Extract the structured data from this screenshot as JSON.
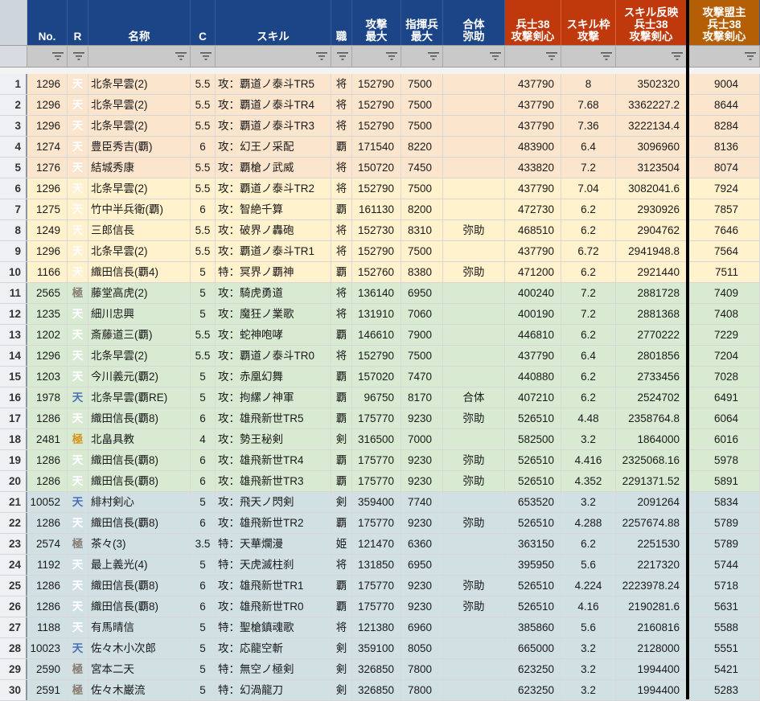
{
  "headers": [
    {
      "key": "no",
      "label": "No.",
      "style": "blue"
    },
    {
      "key": "r",
      "label": "R",
      "style": "blue"
    },
    {
      "key": "name",
      "label": "名称",
      "style": "blue"
    },
    {
      "key": "c",
      "label": "C",
      "style": "blue"
    },
    {
      "key": "skill",
      "label": "スキル",
      "style": "blue"
    },
    {
      "key": "job",
      "label": "職",
      "style": "blue"
    },
    {
      "key": "atk",
      "label": "攻撃\n最大",
      "style": "blue"
    },
    {
      "key": "troops",
      "label": "指揮兵\n最大",
      "style": "blue"
    },
    {
      "key": "combo",
      "label": "合体\n弥助",
      "style": "blue"
    },
    {
      "key": "soldier",
      "label": "兵士38\n攻撃剣心",
      "style": "red"
    },
    {
      "key": "slot",
      "label": "スキル枠\n攻撃",
      "style": "red"
    },
    {
      "key": "reflect",
      "label": "スキル反映\n兵士38\n攻撃剣心",
      "style": "red"
    },
    {
      "key": "lord",
      "label": "攻撃盟主\n兵士38\n攻撃剣心",
      "style": "orange"
    }
  ],
  "colors": {
    "band1": "#fce5cd",
    "band2": "#fff2cc",
    "band3": "#d9ead3",
    "band4": "#d0e0e3"
  },
  "icons": {
    "filter": "filter-icon"
  },
  "rows": [
    {
      "idx": "1",
      "no": "1296",
      "r": "天",
      "rc": "rar-ten",
      "name": "北条早雲(2)",
      "c": "5.5",
      "skill": "攻：覇道ノ泰斗TR5",
      "job": "将",
      "atk": "152790",
      "troops": "7500",
      "combo": "",
      "soldier": "437790",
      "slot": "8",
      "reflect": "3502320",
      "lord": "9004",
      "band": "band1"
    },
    {
      "idx": "2",
      "no": "1296",
      "r": "天",
      "rc": "rar-ten",
      "name": "北条早雲(2)",
      "c": "5.5",
      "skill": "攻：覇道ノ泰斗TR4",
      "job": "将",
      "atk": "152790",
      "troops": "7500",
      "combo": "",
      "soldier": "437790",
      "slot": "7.68",
      "reflect": "3362227.2",
      "lord": "8644",
      "band": "band1"
    },
    {
      "idx": "3",
      "no": "1296",
      "r": "天",
      "rc": "rar-ten",
      "name": "北条早雲(2)",
      "c": "5.5",
      "skill": "攻：覇道ノ泰斗TR3",
      "job": "将",
      "atk": "152790",
      "troops": "7500",
      "combo": "",
      "soldier": "437790",
      "slot": "7.36",
      "reflect": "3222134.4",
      "lord": "8284",
      "band": "band1"
    },
    {
      "idx": "4",
      "no": "1274",
      "r": "天",
      "rc": "rar-ten",
      "name": "豊臣秀吉(覇)",
      "c": "6",
      "skill": "攻：幻王ノ采配",
      "job": "覇",
      "atk": "171540",
      "troops": "8220",
      "combo": "",
      "soldier": "483900",
      "slot": "6.4",
      "reflect": "3096960",
      "lord": "8136",
      "band": "band1"
    },
    {
      "idx": "5",
      "no": "1276",
      "r": "天",
      "rc": "rar-ten",
      "name": "結城秀康",
      "c": "5.5",
      "skill": "攻：覇槍ノ武威",
      "job": "将",
      "atk": "150720",
      "troops": "7450",
      "combo": "",
      "soldier": "433820",
      "slot": "7.2",
      "reflect": "3123504",
      "lord": "8074",
      "band": "band1"
    },
    {
      "idx": "6",
      "no": "1296",
      "r": "天",
      "rc": "rar-ten",
      "name": "北条早雲(2)",
      "c": "5.5",
      "skill": "攻：覇道ノ泰斗TR2",
      "job": "将",
      "atk": "152790",
      "troops": "7500",
      "combo": "",
      "soldier": "437790",
      "slot": "7.04",
      "reflect": "3082041.6",
      "lord": "7924",
      "band": "band2"
    },
    {
      "idx": "7",
      "no": "1275",
      "r": "天",
      "rc": "rar-ten",
      "name": "竹中半兵衛(覇)",
      "c": "6",
      "skill": "攻：智絶千算",
      "job": "覇",
      "atk": "161130",
      "troops": "8200",
      "combo": "",
      "soldier": "472730",
      "slot": "6.2",
      "reflect": "2930926",
      "lord": "7857",
      "band": "band2"
    },
    {
      "idx": "8",
      "no": "1249",
      "r": "天",
      "rc": "rar-ten",
      "name": "三郎信長",
      "c": "5.5",
      "skill": "攻：破界ノ轟砲",
      "job": "将",
      "atk": "152730",
      "troops": "8310",
      "combo": "弥助",
      "soldier": "468510",
      "slot": "6.2",
      "reflect": "2904762",
      "lord": "7646",
      "band": "band2"
    },
    {
      "idx": "9",
      "no": "1296",
      "r": "天",
      "rc": "rar-ten",
      "name": "北条早雲(2)",
      "c": "5.5",
      "skill": "攻：覇道ノ泰斗TR1",
      "job": "将",
      "atk": "152790",
      "troops": "7500",
      "combo": "",
      "soldier": "437790",
      "slot": "6.72",
      "reflect": "2941948.8",
      "lord": "7564",
      "band": "band2"
    },
    {
      "idx": "10",
      "no": "1166",
      "r": "天",
      "rc": "rar-ten",
      "name": "織田信長(覇4)",
      "c": "5",
      "skill": "特：冥界ノ覇神",
      "job": "覇",
      "atk": "152760",
      "troops": "8380",
      "combo": "弥助",
      "soldier": "471200",
      "slot": "6.2",
      "reflect": "2921440",
      "lord": "7511",
      "band": "band2"
    },
    {
      "idx": "11",
      "no": "2565",
      "r": "極",
      "rc": "rar-goku",
      "name": "藤堂高虎(2)",
      "c": "5",
      "skill": "攻：騎虎勇道",
      "job": "将",
      "atk": "136140",
      "troops": "6950",
      "combo": "",
      "soldier": "400240",
      "slot": "7.2",
      "reflect": "2881728",
      "lord": "7409",
      "band": "band3"
    },
    {
      "idx": "12",
      "no": "1235",
      "r": "天",
      "rc": "rar-ten",
      "name": "細川忠興",
      "c": "5",
      "skill": "攻：魔狂ノ業歌",
      "job": "将",
      "atk": "131910",
      "troops": "7060",
      "combo": "",
      "soldier": "400190",
      "slot": "7.2",
      "reflect": "2881368",
      "lord": "7408",
      "band": "band3"
    },
    {
      "idx": "13",
      "no": "1202",
      "r": "天",
      "rc": "rar-ten",
      "name": "斎藤道三(覇)",
      "c": "5.5",
      "skill": "攻：蛇神咆哮",
      "job": "覇",
      "atk": "146610",
      "troops": "7900",
      "combo": "",
      "soldier": "446810",
      "slot": "6.2",
      "reflect": "2770222",
      "lord": "7229",
      "band": "band3"
    },
    {
      "idx": "14",
      "no": "1296",
      "r": "天",
      "rc": "rar-ten",
      "name": "北条早雲(2)",
      "c": "5.5",
      "skill": "攻：覇道ノ泰斗TR0",
      "job": "将",
      "atk": "152790",
      "troops": "7500",
      "combo": "",
      "soldier": "437790",
      "slot": "6.4",
      "reflect": "2801856",
      "lord": "7204",
      "band": "band3"
    },
    {
      "idx": "15",
      "no": "1203",
      "r": "天",
      "rc": "rar-ten",
      "name": "今川義元(覇2)",
      "c": "5",
      "skill": "攻：赤凰幻舞",
      "job": "覇",
      "atk": "157020",
      "troops": "7470",
      "combo": "",
      "soldier": "440880",
      "slot": "6.2",
      "reflect": "2733456",
      "lord": "7028",
      "band": "band3"
    },
    {
      "idx": "16",
      "no": "1978",
      "r": "天",
      "rc": "rar-blue",
      "name": "北条早雲(覇RE)",
      "c": "5",
      "skill": "攻：拘縲ノ神軍",
      "job": "覇",
      "atk": "96750",
      "troops": "8170",
      "combo": "合体",
      "soldier": "407210",
      "slot": "6.2",
      "reflect": "2524702",
      "lord": "6491",
      "band": "band3"
    },
    {
      "idx": "17",
      "no": "1286",
      "r": "天",
      "rc": "rar-ten",
      "name": "織田信長(覇8)",
      "c": "6",
      "skill": "攻：雄飛新世TR5",
      "job": "覇",
      "atk": "175770",
      "troops": "9230",
      "combo": "弥助",
      "soldier": "526510",
      "slot": "4.48",
      "reflect": "2358764.8",
      "lord": "6064",
      "band": "band3"
    },
    {
      "idx": "18",
      "no": "2481",
      "r": "極",
      "rc": "rar-gold",
      "name": "北畠具教",
      "c": "4",
      "skill": "攻：勢王秘剣",
      "job": "剣",
      "atk": "316500",
      "troops": "7000",
      "combo": "",
      "soldier": "582500",
      "slot": "3.2",
      "reflect": "1864000",
      "lord": "6016",
      "band": "band3"
    },
    {
      "idx": "19",
      "no": "1286",
      "r": "天",
      "rc": "rar-ten",
      "name": "織田信長(覇8)",
      "c": "6",
      "skill": "攻：雄飛新世TR4",
      "job": "覇",
      "atk": "175770",
      "troops": "9230",
      "combo": "弥助",
      "soldier": "526510",
      "slot": "4.416",
      "reflect": "2325068.16",
      "lord": "5978",
      "band": "band3"
    },
    {
      "idx": "20",
      "no": "1286",
      "r": "天",
      "rc": "rar-ten",
      "name": "織田信長(覇8)",
      "c": "6",
      "skill": "攻：雄飛新世TR3",
      "job": "覇",
      "atk": "175770",
      "troops": "9230",
      "combo": "弥助",
      "soldier": "526510",
      "slot": "4.352",
      "reflect": "2291371.52",
      "lord": "5891",
      "band": "band3"
    },
    {
      "idx": "21",
      "no": "10052",
      "r": "天",
      "rc": "rar-blue",
      "name": "緋村剣心",
      "c": "5",
      "skill": "攻：飛天ノ閃剣",
      "job": "剣",
      "atk": "359400",
      "troops": "7740",
      "combo": "",
      "soldier": "653520",
      "slot": "3.2",
      "reflect": "2091264",
      "lord": "5834",
      "band": "band4"
    },
    {
      "idx": "22",
      "no": "1286",
      "r": "天",
      "rc": "rar-ten",
      "name": "織田信長(覇8)",
      "c": "6",
      "skill": "攻：雄飛新世TR2",
      "job": "覇",
      "atk": "175770",
      "troops": "9230",
      "combo": "弥助",
      "soldier": "526510",
      "slot": "4.288",
      "reflect": "2257674.88",
      "lord": "5789",
      "band": "band4"
    },
    {
      "idx": "23",
      "no": "2574",
      "r": "極",
      "rc": "rar-goku",
      "name": "茶々(3)",
      "c": "3.5",
      "skill": "特：天華爛漫",
      "job": "姫",
      "atk": "121470",
      "troops": "6360",
      "combo": "",
      "soldier": "363150",
      "slot": "6.2",
      "reflect": "2251530",
      "lord": "5789",
      "band": "band4"
    },
    {
      "idx": "24",
      "no": "1192",
      "r": "天",
      "rc": "rar-ten",
      "name": "最上義光(4)",
      "c": "5",
      "skill": "特：天虎滅柱刹",
      "job": "将",
      "atk": "131850",
      "troops": "6950",
      "combo": "",
      "soldier": "395950",
      "slot": "5.6",
      "reflect": "2217320",
      "lord": "5744",
      "band": "band4"
    },
    {
      "idx": "25",
      "no": "1286",
      "r": "天",
      "rc": "rar-ten",
      "name": "織田信長(覇8)",
      "c": "6",
      "skill": "攻：雄飛新世TR1",
      "job": "覇",
      "atk": "175770",
      "troops": "9230",
      "combo": "弥助",
      "soldier": "526510",
      "slot": "4.224",
      "reflect": "2223978.24",
      "lord": "5718",
      "band": "band4"
    },
    {
      "idx": "26",
      "no": "1286",
      "r": "天",
      "rc": "rar-ten",
      "name": "織田信長(覇8)",
      "c": "6",
      "skill": "攻：雄飛新世TR0",
      "job": "覇",
      "atk": "175770",
      "troops": "9230",
      "combo": "弥助",
      "soldier": "526510",
      "slot": "4.16",
      "reflect": "2190281.6",
      "lord": "5631",
      "band": "band4"
    },
    {
      "idx": "27",
      "no": "1188",
      "r": "天",
      "rc": "rar-ten",
      "name": "有馬晴信",
      "c": "5",
      "skill": "特：聖槍鎮魂歌",
      "job": "将",
      "atk": "121380",
      "troops": "6960",
      "combo": "",
      "soldier": "385860",
      "slot": "5.6",
      "reflect": "2160816",
      "lord": "5588",
      "band": "band4"
    },
    {
      "idx": "28",
      "no": "10023",
      "r": "天",
      "rc": "rar-blue",
      "name": "佐々木小次郎",
      "c": "5",
      "skill": "攻：応龍空斬",
      "job": "剣",
      "atk": "359100",
      "troops": "8050",
      "combo": "",
      "soldier": "665000",
      "slot": "3.2",
      "reflect": "2128000",
      "lord": "5551",
      "band": "band4"
    },
    {
      "idx": "29",
      "no": "2590",
      "r": "極",
      "rc": "rar-goku",
      "name": "宮本二天",
      "c": "5",
      "skill": "特：無空ノ極剣",
      "job": "剣",
      "atk": "326850",
      "troops": "7800",
      "combo": "",
      "soldier": "623250",
      "slot": "3.2",
      "reflect": "1994400",
      "lord": "5421",
      "band": "band4"
    },
    {
      "idx": "30",
      "no": "2591",
      "r": "極",
      "rc": "rar-goku",
      "name": "佐々木巌流",
      "c": "5",
      "skill": "特：幻渦龍刀",
      "job": "剣",
      "atk": "326850",
      "troops": "7800",
      "combo": "",
      "soldier": "623250",
      "slot": "3.2",
      "reflect": "1994400",
      "lord": "5283",
      "band": "band4"
    }
  ]
}
